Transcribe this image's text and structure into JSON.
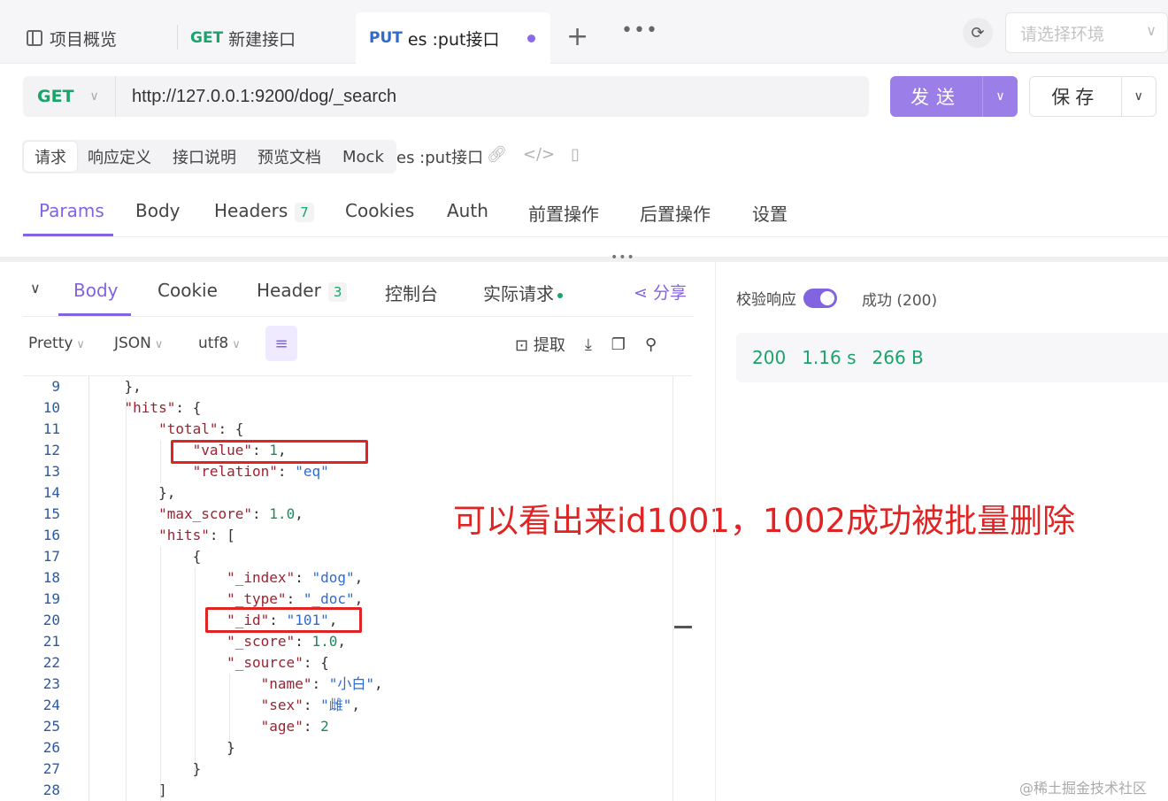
{
  "tabs": {
    "overview": "项目概览",
    "get_method": "GET",
    "get_label": "新建接口",
    "put_method": "PUT",
    "put_label": "es :put接口"
  },
  "env_select": {
    "placeholder": "请选择环境"
  },
  "request": {
    "method": "GET",
    "url": "http://127.0.0.1:9200/dog/_search",
    "send_label": "发送",
    "save_label": "保存"
  },
  "subtabs": [
    "请求",
    "响应定义",
    "接口说明",
    "预览文档",
    "Mock"
  ],
  "doc_title": "es :put接口",
  "param_tabs": {
    "params": "Params",
    "body": "Body",
    "headers": "Headers",
    "headers_count": "7",
    "cookies": "Cookies",
    "auth": "Auth",
    "pre": "前置操作",
    "post": "后置操作",
    "settings": "设置"
  },
  "response_tabs": {
    "body": "Body",
    "cookie": "Cookie",
    "header": "Header",
    "header_count": "3",
    "console": "控制台",
    "actual": "实际请求",
    "share": "分享"
  },
  "toolbar": {
    "format": "Pretty",
    "type": "JSON",
    "encoding": "utf8",
    "extract": "提取"
  },
  "code_lines": [
    {
      "n": "9",
      "t": "    },"
    },
    {
      "n": "10",
      "t": "    \"hits\": {"
    },
    {
      "n": "11",
      "t": "        \"total\": {"
    },
    {
      "n": "12",
      "t": "            \"value\": 1,"
    },
    {
      "n": "13",
      "t": "            \"relation\": \"eq\""
    },
    {
      "n": "14",
      "t": "        },"
    },
    {
      "n": "15",
      "t": "        \"max_score\": 1.0,"
    },
    {
      "n": "16",
      "t": "        \"hits\": ["
    },
    {
      "n": "17",
      "t": "            {"
    },
    {
      "n": "18",
      "t": "                \"_index\": \"dog\","
    },
    {
      "n": "19",
      "t": "                \"_type\": \"_doc\","
    },
    {
      "n": "20",
      "t": "                \"_id\": \"101\","
    },
    {
      "n": "21",
      "t": "                \"_score\": 1.0,"
    },
    {
      "n": "22",
      "t": "                \"_source\": {"
    },
    {
      "n": "23",
      "t": "                    \"name\": \"小白\","
    },
    {
      "n": "24",
      "t": "                    \"sex\": \"雌\","
    },
    {
      "n": "25",
      "t": "                    \"age\": 2"
    },
    {
      "n": "26",
      "t": "                }"
    },
    {
      "n": "27",
      "t": "            }"
    },
    {
      "n": "28",
      "t": "        ]"
    }
  ],
  "annotation": "可以看出来id1001，1002成功被批量删除",
  "right_panel": {
    "validate_label": "校验响应",
    "status_label": "成功 (200)",
    "status_code": "200",
    "time": "1.16 s",
    "size": "266 B"
  },
  "watermark": "@稀土掘金技术社区",
  "colors": {
    "accent": "#8264e0",
    "success": "#1aa36a",
    "annotation": "#e02424"
  }
}
